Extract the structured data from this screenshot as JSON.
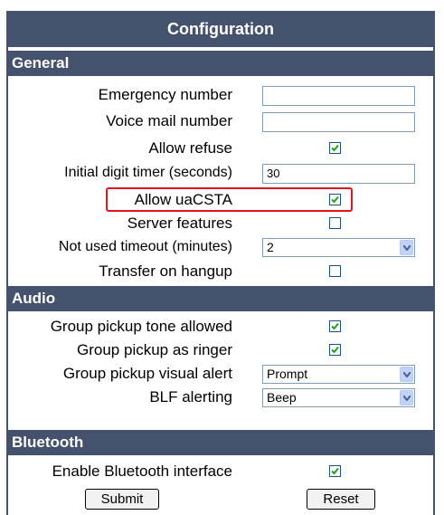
{
  "title": "Configuration",
  "sections": {
    "general": {
      "heading": "General",
      "emergency_number_label": "Emergency number",
      "emergency_number_value": "",
      "voice_mail_label": "Voice mail number",
      "voice_mail_value": "",
      "allow_refuse_label": "Allow refuse",
      "allow_refuse_checked": true,
      "initial_digit_timer_label": "Initial digit timer (seconds)",
      "initial_digit_timer_value": "30",
      "allow_uacsta_label": "Allow uaCSTA",
      "allow_uacsta_checked": true,
      "server_features_label": "Server features",
      "server_features_checked": false,
      "not_used_timeout_label": "Not used timeout (minutes)",
      "not_used_timeout_value": "2",
      "transfer_on_hangup_label": "Transfer on hangup",
      "transfer_on_hangup_checked": false
    },
    "audio": {
      "heading": "Audio",
      "group_pickup_tone_label": "Group pickup tone allowed",
      "group_pickup_tone_checked": true,
      "group_pickup_ringer_label": "Group pickup as ringer",
      "group_pickup_ringer_checked": true,
      "group_pickup_visual_label": "Group pickup visual alert",
      "group_pickup_visual_value": "Prompt",
      "blf_alerting_label": "BLF alerting",
      "blf_alerting_value": "Beep"
    },
    "bluetooth": {
      "heading": "Bluetooth",
      "enable_bluetooth_label": "Enable Bluetooth interface",
      "enable_bluetooth_checked": true
    }
  },
  "buttons": {
    "submit": "Submit",
    "reset": "Reset"
  },
  "colors": {
    "header_bg": "#45526e",
    "highlight": "#e0141d",
    "checkmark": "#21a121"
  }
}
